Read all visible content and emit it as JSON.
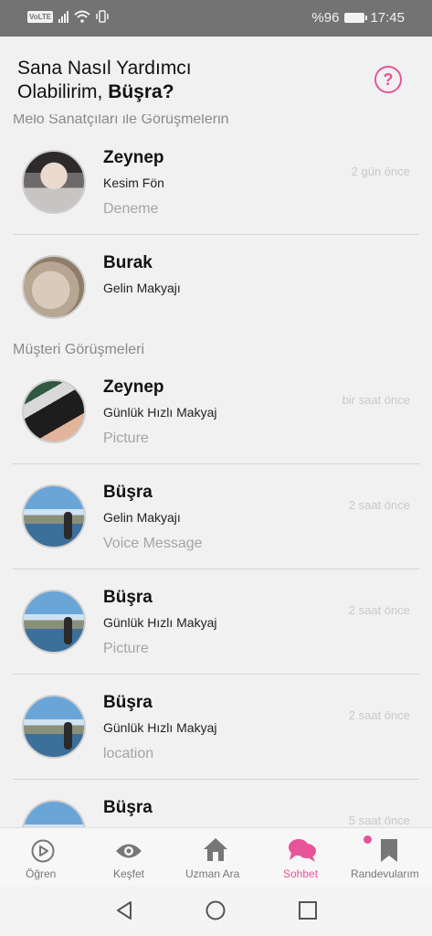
{
  "status_bar": {
    "volte": "VoLTE",
    "battery": "%96",
    "time": "17:45",
    "battery_level": 0.96
  },
  "header": {
    "greeting_line1": "Sana Nasıl Yardımcı",
    "greeting_line2": "Olabilirim,",
    "user_name": "Büşra?",
    "help_icon": "question-circle-icon",
    "accent_color": "#e7549a"
  },
  "sections": {
    "artists_title": "Melo Sanatçıları ile Görüşmelerin",
    "customers_title": "Müşteri Görüşmeleri"
  },
  "artist_conversations": [
    {
      "name": "Zeynep",
      "service": "Kesim Fön",
      "message": "Deneme",
      "time": "2 gün önce"
    },
    {
      "name": "Burak",
      "service": "Gelin Makyajı",
      "message": "",
      "time": ""
    }
  ],
  "customer_conversations": [
    {
      "name": "Zeynep",
      "service": "Günlük Hızlı Makyaj",
      "message": "Picture",
      "time": "bir saat önce"
    },
    {
      "name": "Büşra",
      "service": "Gelin Makyajı",
      "message": "Voice Message",
      "time": "2 saat önce"
    },
    {
      "name": "Büşra",
      "service": "Günlük Hızlı Makyaj",
      "message": "Picture",
      "time": "2 saat önce"
    },
    {
      "name": "Büşra",
      "service": "Günlük Hızlı Makyaj",
      "message": "location",
      "time": "2 saat önce"
    },
    {
      "name": "Büşra",
      "service": "",
      "message": "",
      "time": "5 saat önce"
    }
  ],
  "bottom_nav": [
    {
      "label": "Öğren",
      "icon": "play-circle-icon",
      "active": false
    },
    {
      "label": "Keşfet",
      "icon": "eye-icon",
      "active": false
    },
    {
      "label": "Uzman Ara",
      "icon": "home-icon",
      "active": false
    },
    {
      "label": "Sohbet",
      "icon": "chat-bubble-icon",
      "active": true
    },
    {
      "label": "Randevularım",
      "icon": "bookmark-icon",
      "active": false
    }
  ]
}
